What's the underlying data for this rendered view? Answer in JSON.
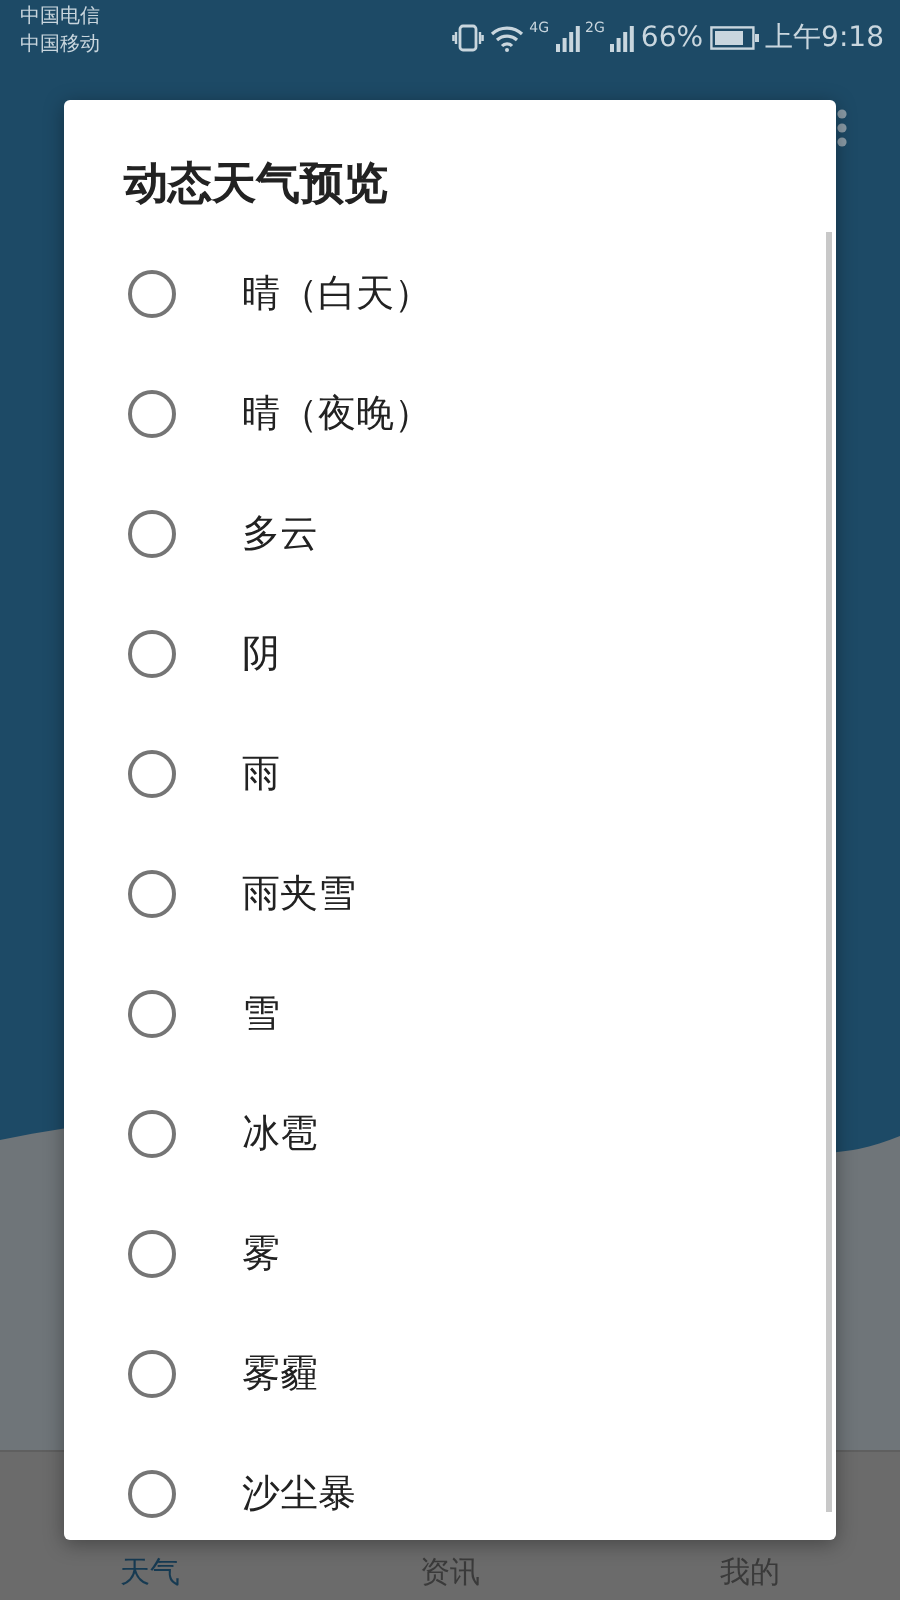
{
  "status_bar": {
    "carriers": [
      "中国电信",
      "中国移动"
    ],
    "network_1": "4G",
    "network_2": "2G",
    "battery": "66%",
    "time": "上午9:18"
  },
  "dialog": {
    "title": "动态天气预览",
    "options": [
      {
        "label": "晴（白天）",
        "selected": false
      },
      {
        "label": "晴（夜晚）",
        "selected": false
      },
      {
        "label": "多云",
        "selected": false
      },
      {
        "label": "阴",
        "selected": false
      },
      {
        "label": "雨",
        "selected": false
      },
      {
        "label": "雨夹雪",
        "selected": false
      },
      {
        "label": "雪",
        "selected": false
      },
      {
        "label": "冰雹",
        "selected": false
      },
      {
        "label": "雾",
        "selected": false
      },
      {
        "label": "雾霾",
        "selected": false
      },
      {
        "label": "沙尘暴",
        "selected": false
      }
    ]
  },
  "bottom_nav": [
    {
      "label": "天气",
      "selected": true
    },
    {
      "label": "资讯",
      "selected": false
    },
    {
      "label": "我的",
      "selected": false
    }
  ]
}
